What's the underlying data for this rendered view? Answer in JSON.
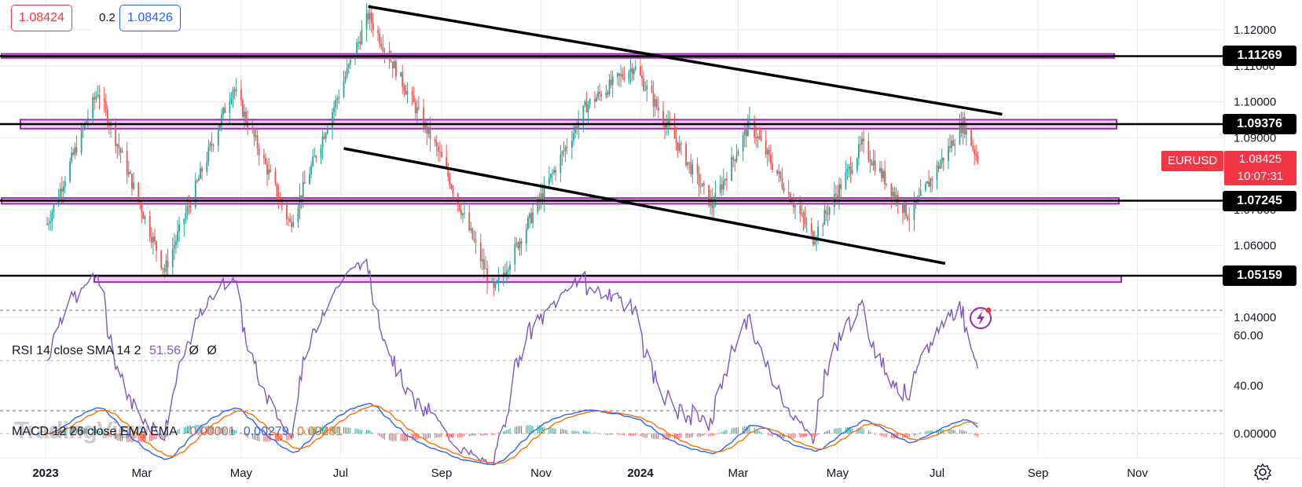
{
  "header": {
    "bid": "1.08424",
    "spread": "0.2",
    "ask": "1.08426"
  },
  "symbol": {
    "name": "EURUSD",
    "price": "1.08425",
    "countdown": "10:07:31",
    "color": "#f23645"
  },
  "watermark": "TradingView",
  "colors": {
    "up": "#26a69a",
    "down": "#ef5350",
    "zone_fill": "#f3cdf5",
    "zone_border": "#9c27b0",
    "rsi": "#7e57c2",
    "macd": "#2962ff",
    "signal": "#ff6d00",
    "trendline": "#000000"
  },
  "price_axis": {
    "ticks": [
      "1.12000",
      "1.11000",
      "1.10000",
      "1.09000",
      "1.07000",
      "1.06000",
      "1.04000"
    ],
    "tick_values": [
      1.12,
      1.11,
      1.1,
      1.09,
      1.07,
      1.06,
      1.04
    ]
  },
  "levels": [
    {
      "value": 1.11269,
      "label": "1.11269"
    },
    {
      "value": 1.09376,
      "label": "1.09376"
    },
    {
      "value": 1.07245,
      "label": "1.07245"
    },
    {
      "value": 1.05159,
      "label": "1.05159"
    }
  ],
  "time_axis": {
    "labels": [
      "2023",
      "Mar",
      "May",
      "Jul",
      "Sep",
      "Nov",
      "2024",
      "Mar",
      "May",
      "Jul",
      "Sep",
      "Nov"
    ],
    "bold": [
      true,
      false,
      false,
      false,
      false,
      false,
      true,
      false,
      false,
      false,
      false,
      false
    ]
  },
  "rsi": {
    "label": "RSI 14 close SMA 14 2",
    "value": "51.56",
    "extra1": "Ø",
    "extra2": "Ø",
    "ticks": [
      "60.00",
      "40.00"
    ]
  },
  "macd": {
    "label": "MACD 12 26 close EMA EMA",
    "hist": "-0.00001",
    "macd_value": "0.00279",
    "signal_value": "0.00281",
    "ticks": [
      "0.00000"
    ]
  },
  "chart_data": {
    "type": "candlestick",
    "symbol": "EURUSD",
    "ylim": [
      1.035,
      1.128
    ],
    "key_points": [
      {
        "date": "2023-01-02",
        "close": 1.066
      },
      {
        "date": "2023-02-02",
        "close": 1.103
      },
      {
        "date": "2023-03-15",
        "close": 1.053
      },
      {
        "date": "2023-04-26",
        "close": 1.104
      },
      {
        "date": "2023-05-31",
        "close": 1.066
      },
      {
        "date": "2023-07-18",
        "close": 1.124
      },
      {
        "date": "2023-08-31",
        "close": 1.085
      },
      {
        "date": "2023-10-03",
        "close": 1.047
      },
      {
        "date": "2023-11-29",
        "close": 1.099
      },
      {
        "date": "2023-12-28",
        "close": 1.11
      },
      {
        "date": "2024-02-14",
        "close": 1.071
      },
      {
        "date": "2024-03-08",
        "close": 1.094
      },
      {
        "date": "2024-04-16",
        "close": 1.062
      },
      {
        "date": "2024-05-16",
        "close": 1.088
      },
      {
        "date": "2024-06-14",
        "close": 1.068
      },
      {
        "date": "2024-07-17",
        "close": 1.094
      },
      {
        "date": "2024-07-26",
        "close": 1.0842
      }
    ],
    "trendlines": [
      {
        "from": {
          "date": "2023-07-18",
          "value": 1.1265
        },
        "to": {
          "date": "2024-08-10",
          "value": 1.0965
        }
      },
      {
        "from": {
          "date": "2023-07-03",
          "value": 1.087
        },
        "to": {
          "date": "2024-07-06",
          "value": 1.055
        }
      }
    ],
    "rsi_range": [
      20,
      80
    ],
    "macd_range": [
      -0.008,
      0.008
    ]
  }
}
